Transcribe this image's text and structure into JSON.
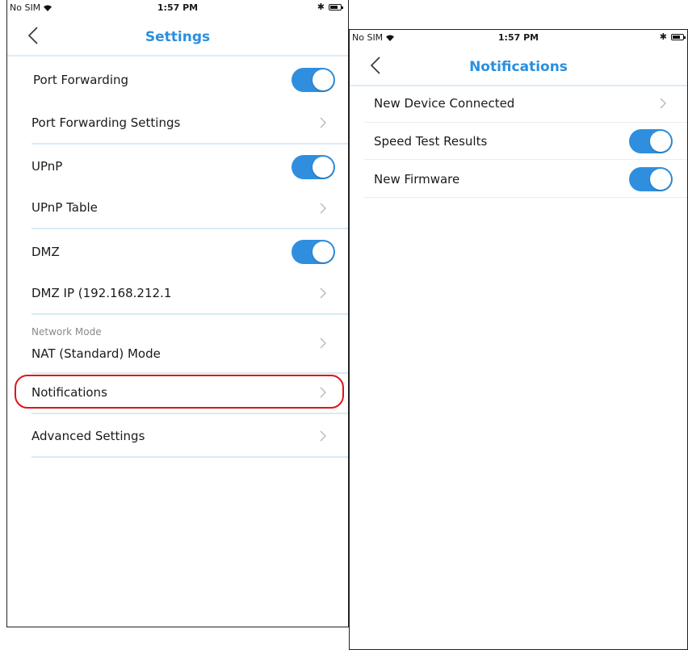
{
  "settings_screen": {
    "status": {
      "carrier": "No SIM",
      "time": "1:57 PM"
    },
    "title": "Settings",
    "rows": [
      {
        "label": "Port Forwarding",
        "control": "toggle",
        "on": true
      },
      {
        "label": "Port Forwarding Settings",
        "control": "chevron"
      },
      {
        "label": "UPnP",
        "control": "toggle",
        "on": true
      },
      {
        "label": "UPnP Table",
        "control": "chevron"
      },
      {
        "label": "DMZ",
        "control": "toggle",
        "on": true
      },
      {
        "label": "DMZ IP (192.168.212.1",
        "control": "chevron"
      },
      {
        "label": "NAT (Standard) Mode",
        "sublabel": "Network Mode",
        "control": "chevron"
      },
      {
        "label": "Notifications",
        "control": "chevron",
        "highlighted": true
      },
      {
        "label": "Advanced Settings",
        "control": "chevron"
      }
    ]
  },
  "notifications_screen": {
    "status": {
      "carrier": "No SIM",
      "time": "1:57 PM"
    },
    "title": "Notifications",
    "rows": [
      {
        "label": "New Device Connected",
        "control": "chevron"
      },
      {
        "label": "Speed Test Results",
        "control": "toggle",
        "on": true
      },
      {
        "label": "New Firmware",
        "control": "toggle",
        "on": true
      }
    ]
  },
  "colors": {
    "accent": "#2f8fde",
    "title": "#2a8fe0",
    "divider": "#d8eaf6",
    "highlight": "#e0141b"
  }
}
